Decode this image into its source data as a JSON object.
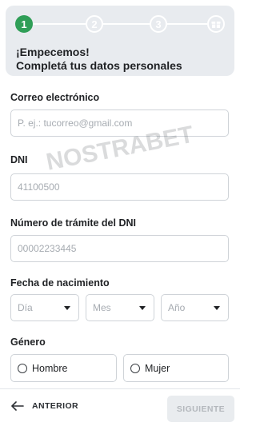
{
  "steps": {
    "items": [
      {
        "number": "1",
        "state": "active"
      },
      {
        "number": "2",
        "state": "pending"
      },
      {
        "number": "3",
        "state": "pending"
      }
    ],
    "final_icon": "gift-icon",
    "title_line1": "¡Empecemos!",
    "title_line2": "Completá tus datos personales"
  },
  "form": {
    "email": {
      "label": "Correo electrónico",
      "placeholder": "P. ej.: tucorreo@gmail.com"
    },
    "dni": {
      "label": "DNI",
      "placeholder": "41100500"
    },
    "tramite": {
      "label": "Número de trámite del DNI",
      "placeholder": "00002233445"
    },
    "birth": {
      "label": "Fecha de nacimiento",
      "day": "Día",
      "month": "Mes",
      "year": "Año"
    },
    "gender": {
      "label": "Género",
      "options": [
        "Hombre",
        "Mujer"
      ]
    }
  },
  "watermark": "NOSTRABET",
  "footer": {
    "back_label": "ANTERIOR",
    "next_label": "SIGUIENTE"
  },
  "colors": {
    "accent": "#2f9e57",
    "header_bg": "#e8ebef",
    "border": "#cfd3d8",
    "disabled_bg": "#e9ecef"
  }
}
